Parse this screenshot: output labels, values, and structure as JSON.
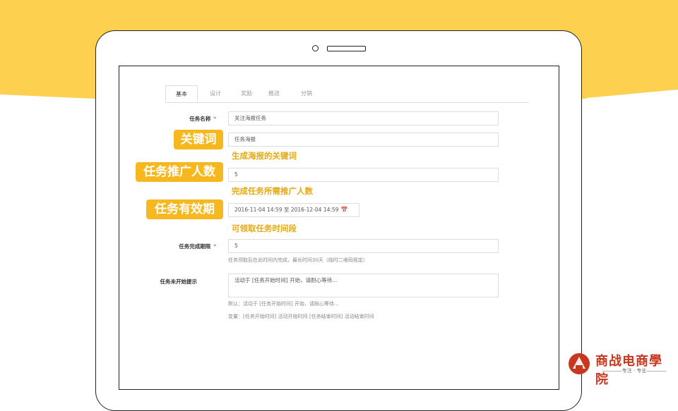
{
  "tabs": [
    "基本",
    "设计",
    "奖励",
    "推送",
    "分销"
  ],
  "form": {
    "task_name_label": "任务名称",
    "required_mark": "*",
    "task_name_value": "关注海报任务",
    "keyword_value": "任务海报",
    "promote_count_value": "5",
    "validity_value": "2016-11-04 14:59 至 2016-12-04 14:59",
    "calendar_icon": "calendar-icon",
    "deadline_label": "任务完成期限",
    "deadline_value": "5",
    "deadline_hint": "任务领取后在此时间内完成，最长时间30天（临时二维码规定）",
    "not_started_label": "任务未开始提示",
    "not_started_value": "活动于 [任务开始时间] 开始，请耐心等待...",
    "default_hint": "默认：活动于 [任务开始时间] 开始，请耐心等待...",
    "variables_hint": "变量：[任务开始时间] 活动开始时间 [任务结束时间] 活动结束时间"
  },
  "annotations": {
    "keyword_badge": "关键词",
    "keyword_note": "生成海报的关键词",
    "promote_badge": "任务推广人数",
    "promote_note": "完成任务所需推广人数",
    "validity_badge": "任务有效期",
    "validity_note": "可领取任务时间段"
  },
  "logo": {
    "title": "商战电商學院",
    "subtitle": "专注 · 专业"
  },
  "colors": {
    "accent": "#f6b81e",
    "background_band": "#fdd04f",
    "required": "#e04a4a",
    "logo": "#c8371f"
  }
}
